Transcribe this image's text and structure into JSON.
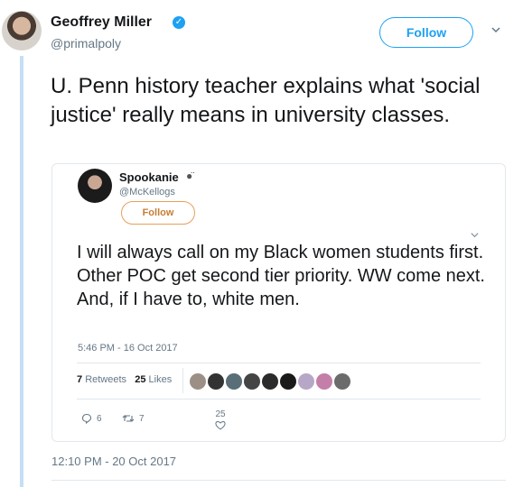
{
  "tweet": {
    "author_name": "Geoffrey Miller",
    "author_handle": "@primalpoly",
    "verified_icon": "verified-check-icon",
    "follow_label": "Follow",
    "text": "U. Penn history teacher explains what 'social justice' really means in university classes.",
    "timestamp": "12:10 PM - 20 Oct 2017",
    "accent_color": "#1da1f2"
  },
  "quoted": {
    "author_name": "Spookanie",
    "author_handle": "@McKellogs",
    "follow_label": "Follow",
    "text": "I will always call on my Black women students first. Other POC get second tier priority. WW come next. And, if I have to, white men.",
    "timestamp": "5:46 PM - 16 Oct 2017",
    "retweets_count": "7",
    "retweets_label": "Retweets",
    "likes_count": "25",
    "likes_label": "Likes",
    "reply_count": "6",
    "retweet_action_count": "7",
    "like_action_count": "25",
    "accent_color": "#e7a15c"
  }
}
